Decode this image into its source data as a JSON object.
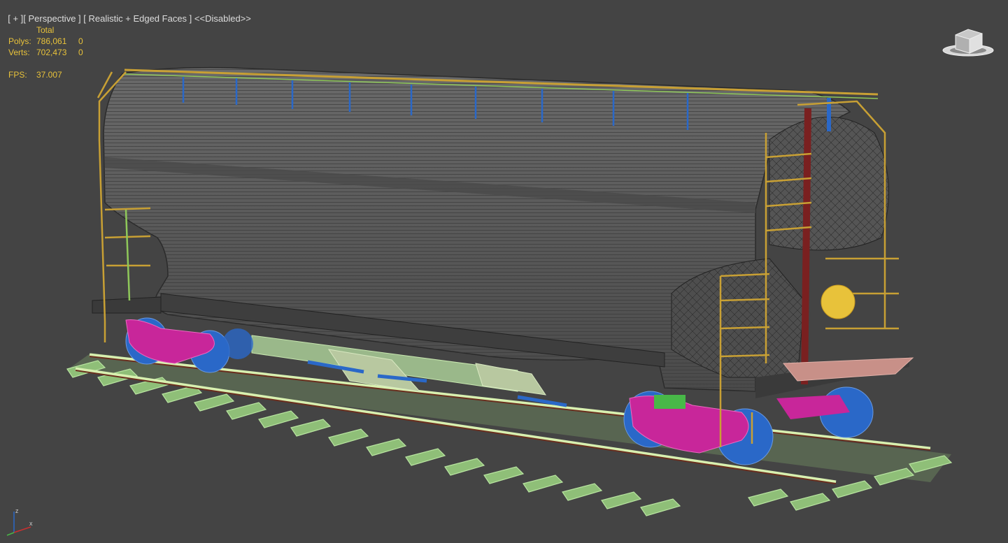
{
  "viewport": {
    "plus_menu": "[ + ]",
    "view_menu": "[ Perspective ]",
    "shading_menu": "[ Realistic + Edged Faces ]",
    "extra_menu": "<<Disabled>>"
  },
  "stats": {
    "total_label": "Total",
    "polys_label": "Polys:",
    "polys_total": "786,061",
    "polys_selected": "0",
    "verts_label": "Verts:",
    "verts_total": "702,473",
    "verts_selected": "0",
    "fps_label": "FPS:",
    "fps_value": "37.007"
  },
  "viewcube": {
    "icon": "viewcube-icon"
  },
  "axis_gizmo": {
    "z_label": "z",
    "x_label": "x"
  },
  "colors": {
    "background": "#444444",
    "stats_text": "#e8c23a",
    "hopper_body": "#5c5c5c",
    "frame_yellow": "#c8a034",
    "bogie_magenta": "#c8269a",
    "wheel_blue": "#2a68c8",
    "rail_green": "#a8d890",
    "rail_dark": "#6a2e1e",
    "ladder_red": "#7a2020"
  }
}
